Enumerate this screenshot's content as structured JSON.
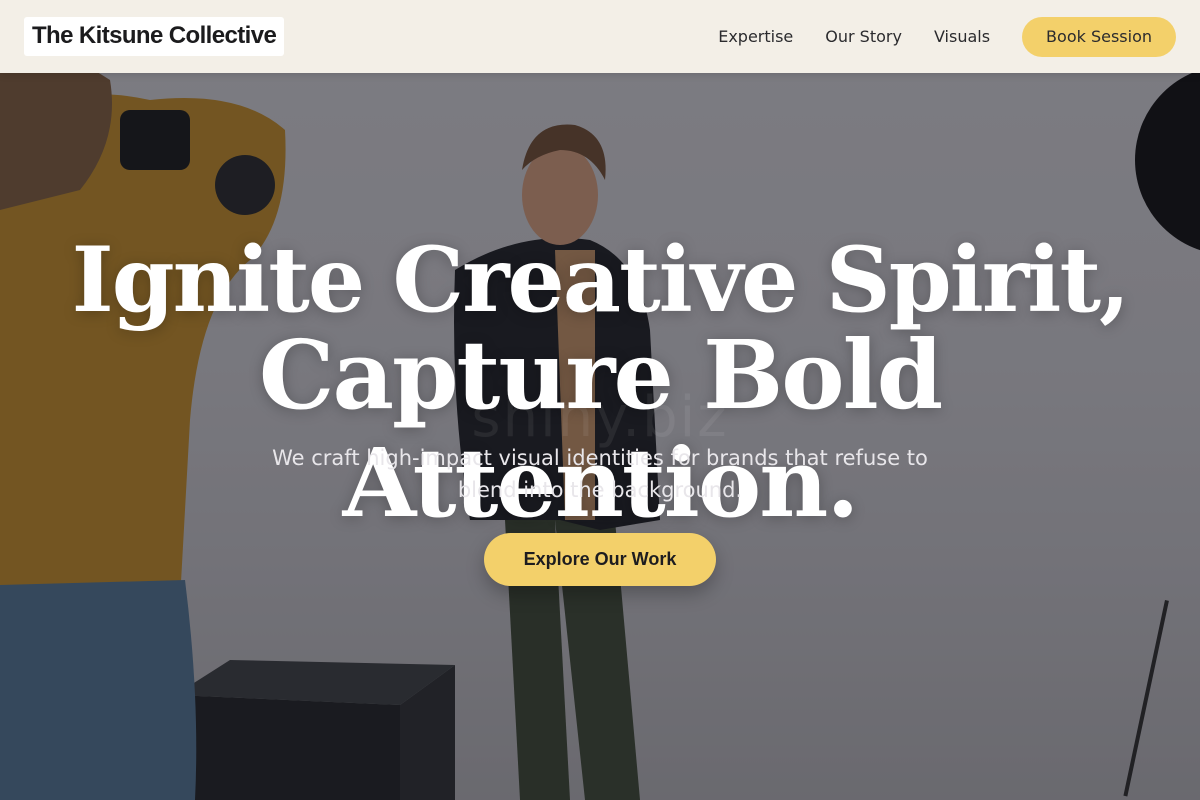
{
  "header": {
    "logo": "The Kitsune Collective",
    "nav": [
      {
        "label": "Expertise"
      },
      {
        "label": "Our Story"
      },
      {
        "label": "Visuals"
      }
    ],
    "cta_label": "Book Session"
  },
  "hero": {
    "headline_line1": "Ignite Creative Spirit,",
    "headline_line2": "Capture Bold Attention.",
    "subtitle": "We craft high-impact visual identities for brands that refuse to blend into the background.",
    "cta_label": "Explore Our Work",
    "watermark": "shiny.biz"
  },
  "colors": {
    "accent": "#f3d06a",
    "header_bg": "#f3efe7",
    "headline": "#ffffff"
  }
}
